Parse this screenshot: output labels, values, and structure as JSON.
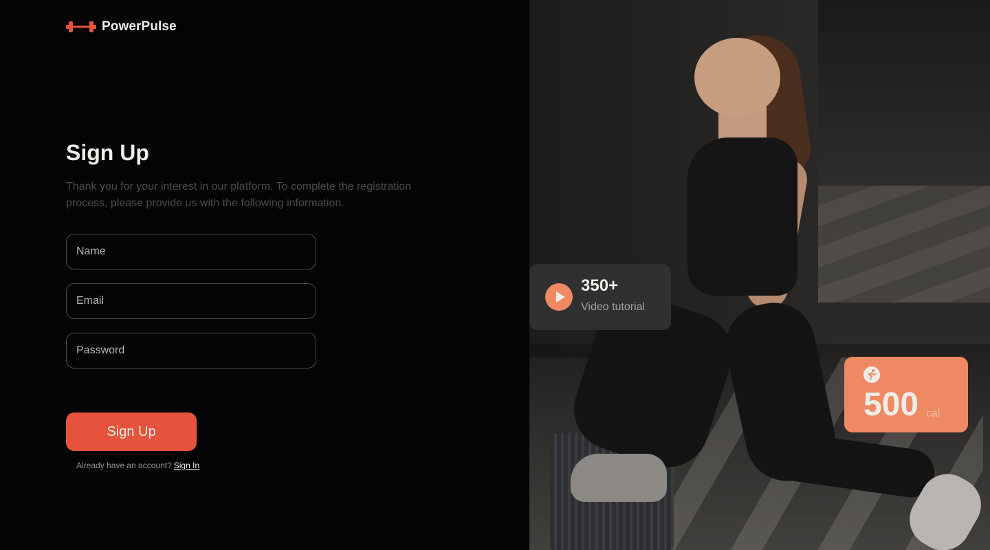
{
  "brand": {
    "name": "PowerPulse",
    "logo_icon": "dumbbell-icon",
    "accent": "#e6533c"
  },
  "form": {
    "title": "Sign Up",
    "subtitle": "Thank you for your interest in our platform. To complete the registration process, please provide us with the following information.",
    "name_placeholder": "Name",
    "email_placeholder": "Email",
    "password_placeholder": "Password",
    "submit_label": "Sign Up",
    "signin_prompt": "Already have an account?",
    "signin_link": "Sign In"
  },
  "stats": {
    "video_count": "350+",
    "video_label": "Video tutorial",
    "video_icon": "play-icon",
    "calories_value": "500",
    "calories_unit": "cal",
    "calories_icon": "running-icon",
    "card_color": "#ef8964"
  }
}
